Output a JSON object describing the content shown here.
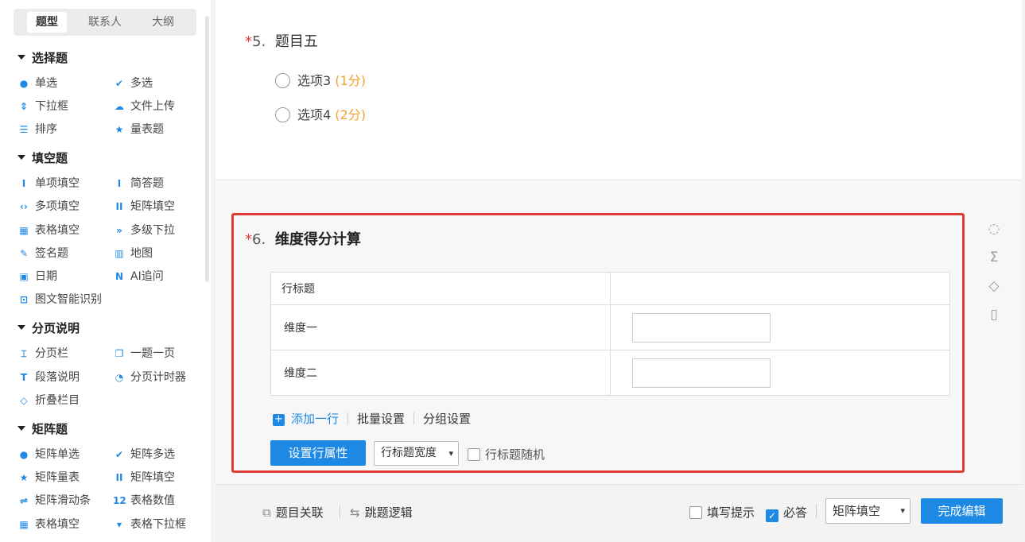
{
  "sidebar": {
    "tabs": [
      "题型",
      "联系人",
      "大纲"
    ],
    "active_tab": 0,
    "groups": [
      {
        "title": "选择题",
        "items": [
          {
            "label": "单选",
            "icon": "radio-dot-icon"
          },
          {
            "label": "多选",
            "icon": "checkmark-icon"
          },
          {
            "label": "下拉框",
            "icon": "sort-arrows-icon"
          },
          {
            "label": "文件上传",
            "icon": "cloud-upload-icon"
          },
          {
            "label": "排序",
            "icon": "list-icon"
          },
          {
            "label": "量表题",
            "icon": "star-icon"
          }
        ]
      },
      {
        "title": "填空题",
        "items": [
          {
            "label": "单项填空",
            "icon": "text-cursor-icon"
          },
          {
            "label": "简答题",
            "icon": "text-cursor-icon"
          },
          {
            "label": "多项填空",
            "icon": "brackets-icon"
          },
          {
            "label": "矩阵填空",
            "icon": "double-cursor-icon"
          },
          {
            "label": "表格填空",
            "icon": "table-icon"
          },
          {
            "label": "多级下拉",
            "icon": "double-chevron-icon"
          },
          {
            "label": "签名题",
            "icon": "pen-icon"
          },
          {
            "label": "地图",
            "icon": "map-icon"
          },
          {
            "label": "日期",
            "icon": "calendar-icon"
          },
          {
            "label": "AI追问",
            "icon": "ai-icon"
          },
          {
            "label": "图文智能识别",
            "icon": "image-text-icon"
          }
        ]
      },
      {
        "title": "分页说明",
        "items": [
          {
            "label": "分页栏",
            "icon": "page-break-icon"
          },
          {
            "label": "一题一页",
            "icon": "pages-icon"
          },
          {
            "label": "段落说明",
            "icon": "paragraph-icon"
          },
          {
            "label": "分页计时器",
            "icon": "timer-icon"
          },
          {
            "label": "折叠栏目",
            "icon": "collapse-icon"
          }
        ]
      },
      {
        "title": "矩阵题",
        "items": [
          {
            "label": "矩阵单选",
            "icon": "matrix-radio-icon"
          },
          {
            "label": "矩阵多选",
            "icon": "checkmark-icon"
          },
          {
            "label": "矩阵量表",
            "icon": "star-grid-icon"
          },
          {
            "label": "矩阵填空",
            "icon": "double-cursor-icon"
          },
          {
            "label": "矩阵滑动条",
            "icon": "slider-icon"
          },
          {
            "label": "表格数值",
            "icon": "number-icon"
          },
          {
            "label": "表格填空",
            "icon": "table-icon"
          },
          {
            "label": "表格下拉框",
            "icon": "dropdown-box-icon"
          }
        ]
      }
    ]
  },
  "q5": {
    "star": "*",
    "number": "5.",
    "title": "题目五",
    "options": [
      {
        "label": "选项3",
        "score": "(1分)"
      },
      {
        "label": "选项4",
        "score": "(2分)"
      }
    ]
  },
  "q6": {
    "star": "*",
    "number": "6.",
    "title": "维度得分计算",
    "table_header": "行标题",
    "rows": [
      "维度一",
      "维度二"
    ],
    "add_row": "添加一行",
    "batch_settings": "批量设置",
    "group_settings": "分组设置",
    "set_row_props": "设置行属性",
    "row_title_width": "行标题宽度",
    "row_title_random": "行标题随机"
  },
  "footer": {
    "related": "题目关联",
    "jump_logic": "跳题逻辑",
    "fill_hint": "填写提示",
    "fill_hint_checked": false,
    "required": "必答",
    "required_checked": true,
    "question_type": "矩阵填空",
    "finish": "完成编辑"
  },
  "side_tools": [
    "eye-slash-icon",
    "sigma-icon",
    "tag-icon",
    "trash-icon"
  ],
  "colors": {
    "accent": "#1e88e5",
    "required_star": "#e4393c",
    "score": "#f0a32f",
    "highlight": "#e23b36"
  }
}
